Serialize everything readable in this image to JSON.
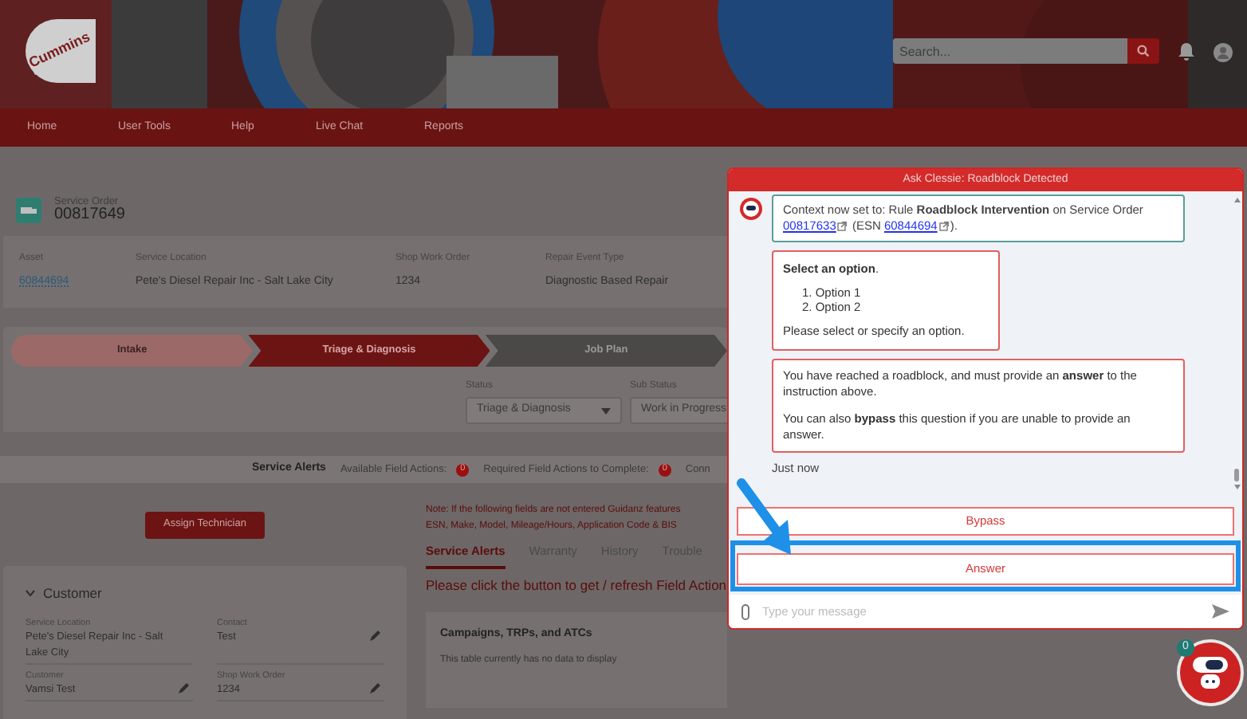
{
  "header": {
    "logo_text": "Cummins",
    "search": {
      "placeholder": "Search..."
    }
  },
  "nav": [
    {
      "label": "Home"
    },
    {
      "label": "User Tools"
    },
    {
      "label": "Help"
    },
    {
      "label": "Live Chat"
    },
    {
      "label": "Reports"
    }
  ],
  "service_order": {
    "label": "Service Order",
    "number": "00817649"
  },
  "info": [
    {
      "label": "Asset",
      "value": "60844694",
      "kind": "link"
    },
    {
      "label": "Service Location",
      "value": "Pete's Diesel Repair Inc - Salt Lake City",
      "kind": "text"
    },
    {
      "label": "Shop Work Order",
      "value": "1234",
      "kind": "text"
    },
    {
      "label": "Repair Event Type",
      "value": "Diagnostic Based Repair",
      "kind": "text"
    }
  ],
  "path": [
    {
      "label": "Intake",
      "completed": true,
      "selected": false
    },
    {
      "label": "Triage & Diagnosis",
      "completed": false,
      "selected": true
    },
    {
      "label": "Job Plan",
      "completed": false,
      "selected": false
    }
  ],
  "status_fields": [
    {
      "label": "Status",
      "value": "Triage & Diagnosis"
    },
    {
      "label": "Sub Status",
      "value": "Work in Progress"
    }
  ],
  "alerts_bar": {
    "title": "Service Alerts",
    "counters": [
      {
        "label": "Available Field Actions:",
        "count": "0"
      },
      {
        "label": "Required Field Actions to Complete:",
        "count": "0"
      }
    ],
    "more": "Conn"
  },
  "assign_button": "Assign Technician",
  "note": [
    "Note: If the following fields are not entered Guidanz features",
    "ESN, Make, Model, Mileage/Hours, Application Code  & BIS"
  ],
  "customer": {
    "title": "Customer",
    "expanded": true,
    "fields": [
      {
        "label": "Service Location",
        "value": "Pete's Diesel Repair Inc - Salt Lake City",
        "editable": false
      },
      {
        "label": "Contact",
        "value": "Test",
        "editable": true
      },
      {
        "label": "Customer",
        "value": "Vamsi Test",
        "editable": true
      },
      {
        "label": "Shop Work Order",
        "value": "1234",
        "editable": true
      }
    ]
  },
  "tabs": [
    {
      "label": "Service Alerts",
      "selected": true
    },
    {
      "label": "Warranty",
      "selected": false
    },
    {
      "label": "History",
      "selected": false
    },
    {
      "label": "Trouble",
      "selected": false
    }
  ],
  "refresh_message": "Please click the button to get / refresh Field Action",
  "campaigns": {
    "title": "Campaigns, TRPs, and ATCs",
    "empty": "This table currently has no data to display"
  },
  "chat": {
    "title": "Ask Clessie: Roadblock Detected",
    "messages": [
      {
        "kind": "context",
        "color": "#5a9e9c",
        "parts": [
          {
            "kind": "text",
            "text": "Context now set to: Rule **Roadblock Intervention** on Service Order "
          },
          {
            "kind": "link",
            "text": "00817633"
          },
          {
            "kind": "text",
            "text": " (ESN "
          },
          {
            "kind": "link",
            "text": "60844694"
          },
          {
            "kind": "text",
            "text": ")."
          }
        ]
      },
      {
        "kind": "options",
        "color": "#e06060",
        "heading": "**Select an option**.",
        "options": [
          "1. Option 1",
          "2. Option 2"
        ],
        "footer": "Please select or specify an option."
      },
      {
        "kind": "paragraphs",
        "color": "#e06060",
        "paragraphs": [
          "You have reached a roadblock, and must provide an **answer** to the instruction above.",
          "You can also **bypass** this question if you are unable to provide an answer."
        ]
      }
    ],
    "timestamp": "Just now",
    "actions": [
      {
        "label": "Bypass",
        "highlighted": false
      },
      {
        "label": "Answer",
        "highlighted": true
      }
    ],
    "input": {
      "placeholder": "Type your message"
    }
  },
  "bot_badge": "0"
}
